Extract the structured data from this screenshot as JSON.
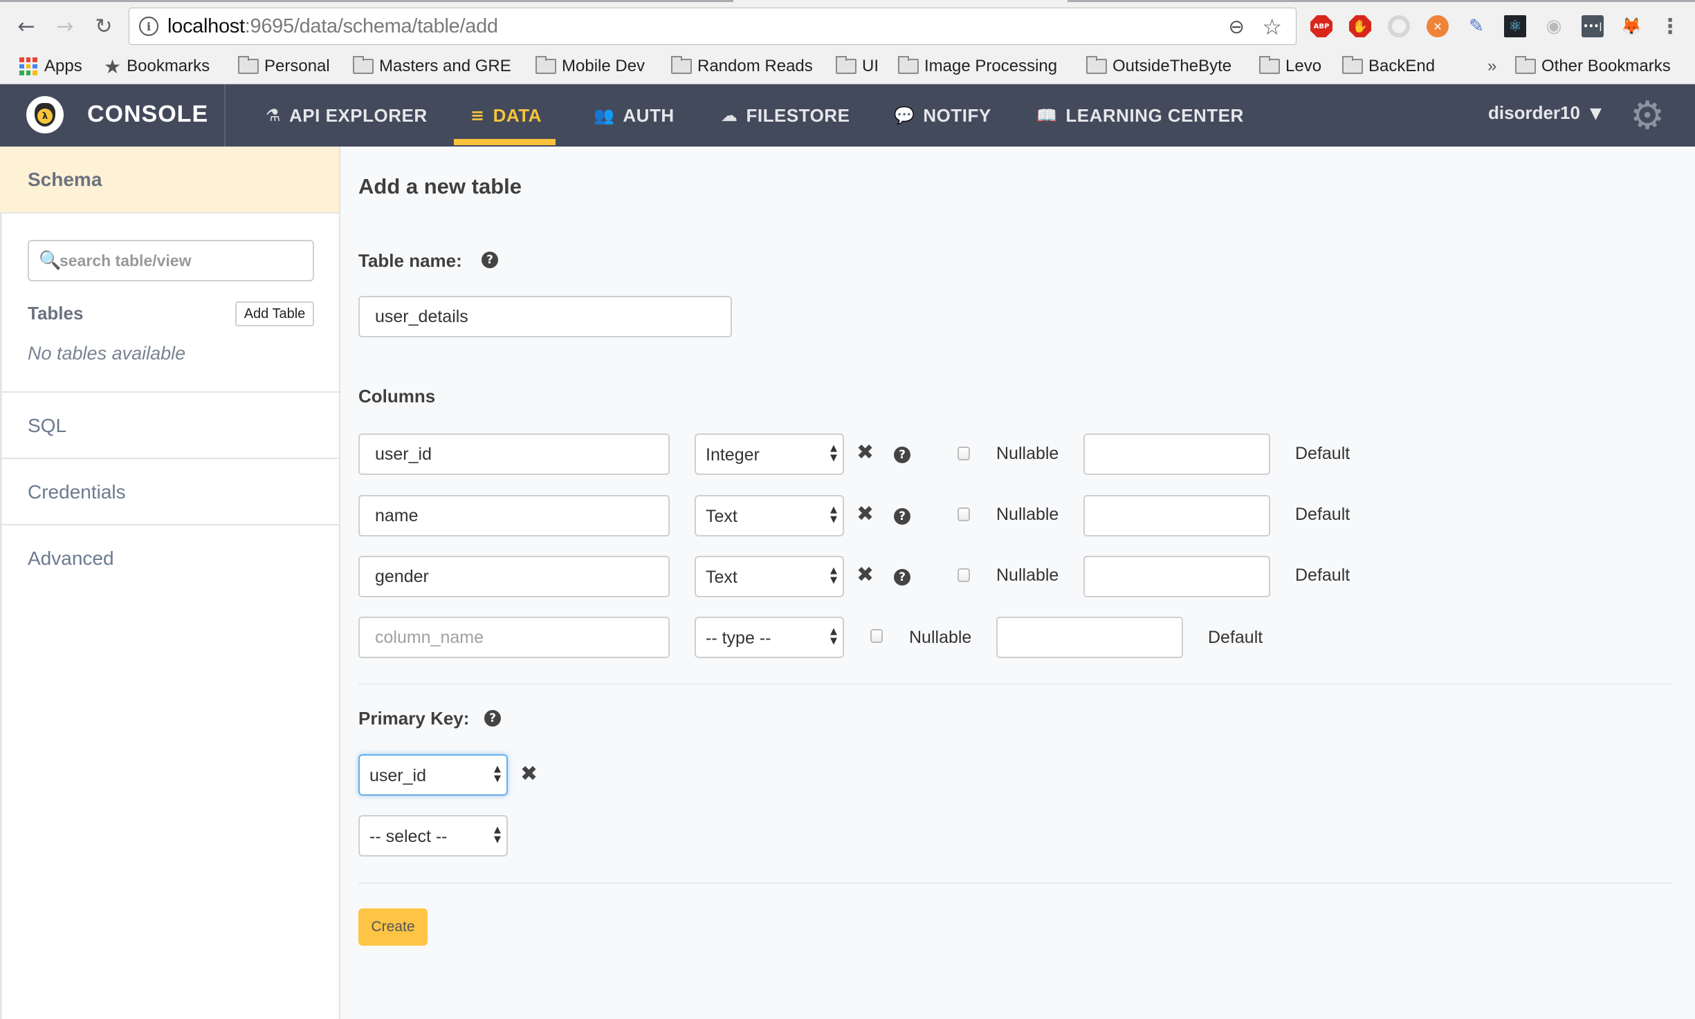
{
  "browser": {
    "nav": {
      "back_icon": "arrow-left-icon",
      "forward_icon": "arrow-right-icon",
      "reload_icon": "reload-icon"
    },
    "url": {
      "host": "localhost",
      "rest": ":9695/data/schema/table/add"
    },
    "extensions": [
      "adblock-plus",
      "ublock",
      "json-viewer",
      "orange-extension",
      "color-picker",
      "react-devtools",
      "podcast",
      "lastpass",
      "metamask",
      "chrome-menu"
    ],
    "extension_labels": {
      "abp": "ABP",
      "lastpass": "•••|"
    },
    "bookmarks": {
      "apps": "Apps",
      "bookmarks": "Bookmarks",
      "folders": [
        "Personal",
        "Masters and GRE",
        "Mobile Dev",
        "Random Reads",
        "UI",
        "Image Processing",
        "OutsideTheByte",
        "Levo",
        "BackEnd"
      ],
      "overflow": "»",
      "other": "Other Bookmarks"
    }
  },
  "app": {
    "brand": "CONSOLE",
    "nav_tabs": [
      {
        "label": "API EXPLORER",
        "icon": "flask-icon",
        "active": false
      },
      {
        "label": "DATA",
        "icon": "database-icon",
        "active": true
      },
      {
        "label": "AUTH",
        "icon": "users-icon",
        "active": false
      },
      {
        "label": "FILESTORE",
        "icon": "cloud-upload-icon",
        "active": false
      },
      {
        "label": "NOTIFY",
        "icon": "comment-icon",
        "active": false
      },
      {
        "label": "LEARNING CENTER",
        "icon": "book-icon",
        "active": false
      }
    ],
    "user": "disorder10",
    "accent": "#f9c33c",
    "nav_bg": "#434a5c"
  },
  "sidebar": {
    "header": "Schema",
    "search_placeholder": "search table/view",
    "tables_label": "Tables",
    "add_table_label": "Add Table",
    "empty_text": "No tables available",
    "items": [
      "SQL",
      "Credentials",
      "Advanced"
    ]
  },
  "main": {
    "title": "Add a new table",
    "table_name_label": "Table name:",
    "table_name_value": "user_details",
    "columns_label": "Columns",
    "columns": [
      {
        "name": "user_id",
        "type": "Integer",
        "nullable": false,
        "default": ""
      },
      {
        "name": "name",
        "type": "Text",
        "nullable": false,
        "default": ""
      },
      {
        "name": "gender",
        "type": "Text",
        "nullable": false,
        "default": ""
      }
    ],
    "new_column": {
      "name_placeholder": "column_name",
      "type_placeholder": "-- type --"
    },
    "nullable_label": "Nullable",
    "default_label": "Default",
    "primary_key_label": "Primary Key:",
    "primary_keys": [
      "user_id"
    ],
    "pk_select_placeholder": "-- select --",
    "create_label": "Create"
  }
}
